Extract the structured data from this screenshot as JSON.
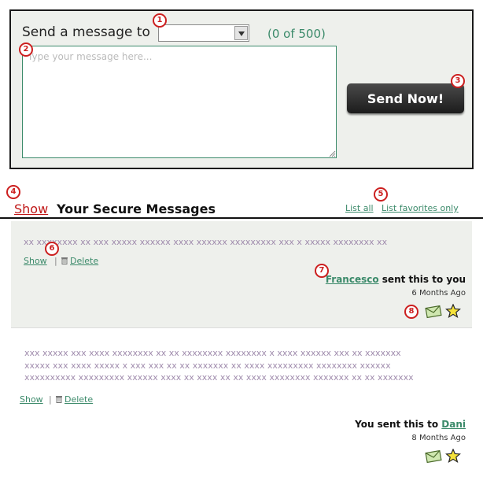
{
  "compose": {
    "label": "Send a message to",
    "recipient_value": "",
    "counter": "(0 of 500)",
    "message_placeholder": "Type your message here...",
    "message_value": "",
    "send_label": "Send Now!"
  },
  "badges": [
    "1",
    "2",
    "3",
    "4",
    "5",
    "6",
    "7",
    "8"
  ],
  "list": {
    "show_label": "Show",
    "title": "Your Secure Messages",
    "list_all": "List all",
    "list_favorites": "List favorites only"
  },
  "messages": [
    {
      "preview_lines": [
        "xx xxxxxxxx xx xxx xxxxx xxxxxx xxxx  xxxxxx xxxxxxxxx xxx x xxxxx xxxxxxxx xx"
      ],
      "show_label": "Show",
      "delete_label": "Delete",
      "sender": "Francesco",
      "sent_text": "sent this to you",
      "time_ago": "6 Months Ago"
    },
    {
      "preview_lines": [
        "xxx xxxxx xxx xxxx xxxxxxxx xx xx xxxxxxxx xxxxxxxx x xxxx xxxxxx xxx xx xxxxxxx",
        "xxxxx xxx xxxx xxxxx x xxx xxx xx xx xxxxxxx xx xxxx xxxxxxxxx xxxxxxxx xxxxxx",
        "xxxxxxxxxx xxxxxxxxx xxxxxx xxxx xx xxxx xx xx xxxx xxxxxxxx xxxxxxx xx xx xxxxxxx"
      ],
      "show_label": "Show",
      "delete_label": "Delete",
      "sent_text": "You sent this to",
      "recipient": "Dani",
      "time_ago": "8 Months Ago"
    }
  ],
  "icons": {
    "envelope": "envelope-icon",
    "star": "star-icon",
    "trash": "trash-icon",
    "dropdown": "chevron-down-icon"
  },
  "colors": {
    "accent_green": "#3b8a6a",
    "badge_red": "#cc1f1f",
    "show_red": "#c01818",
    "panel_bg": "#eef0ec",
    "star_yellow": "#f5e23a"
  }
}
